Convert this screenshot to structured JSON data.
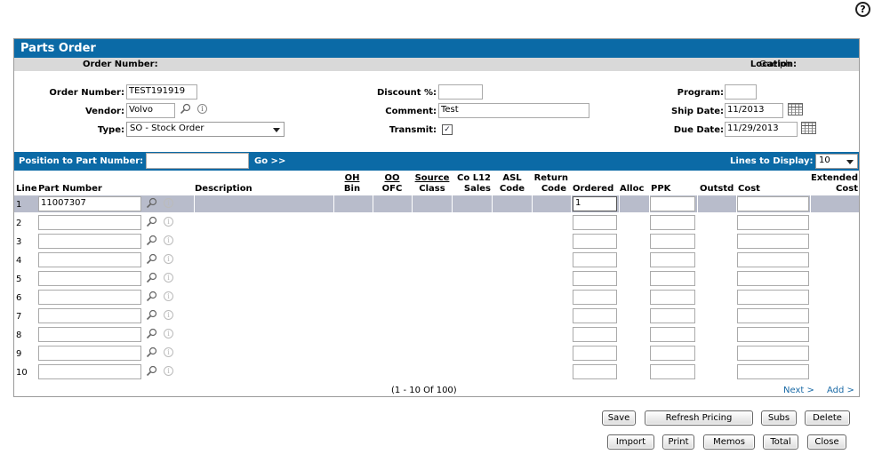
{
  "page": {
    "help_glyph": "?"
  },
  "panel": {
    "title": "Parts Order"
  },
  "subheader": {
    "order_number_label": "Order Number:",
    "location_label": "Location:",
    "location_value": "Guelph"
  },
  "form": {
    "order_number_label": "Order Number:",
    "order_number": "TEST191919",
    "vendor_label": "Vendor:",
    "vendor": "Volvo",
    "type_label": "Type:",
    "type_value": "SO - Stock Order",
    "discount_label": "Discount %:",
    "discount": "",
    "comment_label": "Comment:",
    "comment": "Test",
    "transmit_label": "Transmit:",
    "transmit_checked": true,
    "transmit_mark": "✓",
    "program_label": "Program:",
    "program": "",
    "ship_date_label": "Ship Date:",
    "ship_date": "11/2013",
    "due_date_label": "Due Date:",
    "due_date": "11/29/2013"
  },
  "position_bar": {
    "label": "Position to Part Number:",
    "value": "",
    "go_label": "Go >>",
    "lines_label": "Lines to Display:",
    "lines_value": "10"
  },
  "columns": {
    "line": "Line",
    "part_number": "Part Number",
    "description": "Description",
    "oh": "OH",
    "bin": "Bin",
    "oo": "OO",
    "ofc": "OFC",
    "source": "Source",
    "class": "Class",
    "co_l12": "Co L12",
    "sales": "Sales",
    "asl": "ASL",
    "code": "Code",
    "return": "Return",
    "return_code": "Code",
    "ordered": "Ordered",
    "alloc": "Alloc",
    "ppk": "PPK",
    "outstd": "Outstd",
    "cost": "Cost",
    "extended": "Extended",
    "extended_cost": "Cost"
  },
  "rows": [
    {
      "line": "1",
      "part_number": "11007307",
      "ordered": "1"
    },
    {
      "line": "2",
      "part_number": "",
      "ordered": ""
    },
    {
      "line": "3",
      "part_number": "",
      "ordered": ""
    },
    {
      "line": "4",
      "part_number": "",
      "ordered": ""
    },
    {
      "line": "5",
      "part_number": "",
      "ordered": ""
    },
    {
      "line": "6",
      "part_number": "",
      "ordered": ""
    },
    {
      "line": "7",
      "part_number": "",
      "ordered": ""
    },
    {
      "line": "8",
      "part_number": "",
      "ordered": ""
    },
    {
      "line": "9",
      "part_number": "",
      "ordered": ""
    },
    {
      "line": "10",
      "part_number": "",
      "ordered": ""
    }
  ],
  "pager": {
    "range": "(1 - 10 Of 100)",
    "next": "Next >",
    "add": "Add >"
  },
  "buttons": {
    "save": "Save",
    "refresh_pricing": "Refresh Pricing",
    "subs": "Subs",
    "delete": "Delete",
    "import": "Import",
    "print": "Print",
    "memos": "Memos",
    "total": "Total",
    "close": "Close"
  },
  "colors": {
    "header_blue": "#0b6aa6",
    "subheader_gray": "#d9d9d9",
    "row_highlight": "#b8bccb",
    "link": "#1a6aa6"
  }
}
